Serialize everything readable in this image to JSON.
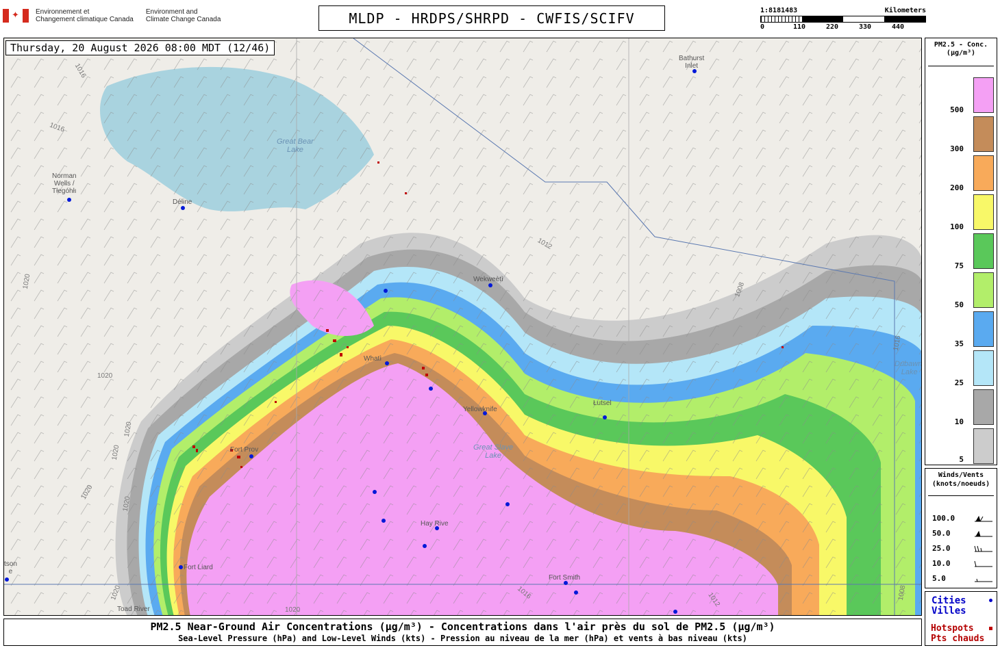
{
  "header": {
    "gov_fr": [
      "Environnement et",
      "Changement climatique Canada"
    ],
    "gov_en": [
      "Environment and",
      "Climate Change Canada"
    ],
    "title": "MLDP - HRDPS/SHRPD - CWFIS/SCIFV",
    "scale": {
      "ratio": "1:8181483",
      "unit": "Kilometers",
      "ticks": [
        "0",
        "110",
        "220",
        "330",
        "440"
      ]
    }
  },
  "map": {
    "timestamp": "Thursday, 20 August 2026 08:00 MDT (12/46)",
    "places": [
      {
        "name": "Norman Wells / Tłegóhłı",
        "lines": [
          "Norman",
          "Wells /",
          "Tłegóhłı"
        ]
      },
      {
        "name": "Déline",
        "lines": [
          "Déline"
        ]
      },
      {
        "name": "Wekweètì",
        "lines": [
          "Wekweètì"
        ]
      },
      {
        "name": "Whatì",
        "lines": [
          "Whatì"
        ]
      },
      {
        "name": "Yellowknife",
        "lines": [
          "Yellowknife"
        ]
      },
      {
        "name": "Łutselk'e",
        "lines": [
          "Łutsel"
        ]
      },
      {
        "name": "Fort Providence",
        "lines": [
          "Fort Prov"
        ]
      },
      {
        "name": "Hay River",
        "lines": [
          "Hay Rive"
        ]
      },
      {
        "name": "Fort Smith",
        "lines": [
          "Fort Smith"
        ]
      },
      {
        "name": "Fort Liard",
        "lines": [
          "Fort Liard"
        ]
      },
      {
        "name": "Toad River",
        "lines": [
          "Toad River"
        ]
      },
      {
        "name": "Watson Lake",
        "lines": [
          "tson",
          "e"
        ]
      },
      {
        "name": "Bathurst Inlet",
        "lines": [
          "Bathurst",
          "Inlet"
        ]
      }
    ],
    "lakes": [
      {
        "lines": [
          "Great Bear",
          "Lake"
        ]
      },
      {
        "lines": [
          "Great Slave",
          "Lake"
        ]
      },
      {
        "lines": [
          "Dubawnt",
          "Lake"
        ]
      }
    ],
    "isobars": [
      "1016",
      "1016",
      "1020",
      "1020",
      "1020",
      "1020",
      "1020",
      "1020",
      "1012",
      "1008",
      "1016",
      "1012",
      "1008",
      "1016",
      "1020",
      "1020"
    ],
    "colors": {
      "land": "#efede8",
      "water": "#a9d3df",
      "pm_5": "#cccccc",
      "pm_10": "#a8a8a8",
      "pm_25": "#b4e6f8",
      "pm_35": "#5aaaf0",
      "pm_50": "#b2ee6a",
      "pm_75": "#5ac85a",
      "pm_100": "#f8f868",
      "pm_200": "#f8aa5a",
      "pm_300": "#c48c5a",
      "pm_500": "#f4a0f4",
      "hotspot": "#c00000",
      "city": "#0018d8"
    }
  },
  "legend": {
    "pm_header": [
      "PM2.5 - Conc.",
      "(µg/m³)"
    ],
    "pm_levels": [
      "500",
      "300",
      "200",
      "100",
      "75",
      "50",
      "35",
      "25",
      "10",
      "5"
    ],
    "wind_header": [
      "Winds/Vents",
      "(knots/noeuds)"
    ],
    "wind_levels": [
      "100.0",
      "50.0",
      "25.0",
      "10.0",
      "5.0"
    ],
    "cities": [
      "Cities",
      "Villes"
    ],
    "hotspots": [
      "Hotspots",
      "Pts chauds"
    ]
  },
  "footer": {
    "line1": "PM2.5 Near-Ground Air Concentrations (µg/m³) - Concentrations dans l'air près du sol de PM2.5 (µg/m³)",
    "line2": "Sea-Level Pressure (hPa) and Low-Level Winds (kts) - Pression au niveau de la mer (hPa) et vents à bas niveau (kts)"
  }
}
